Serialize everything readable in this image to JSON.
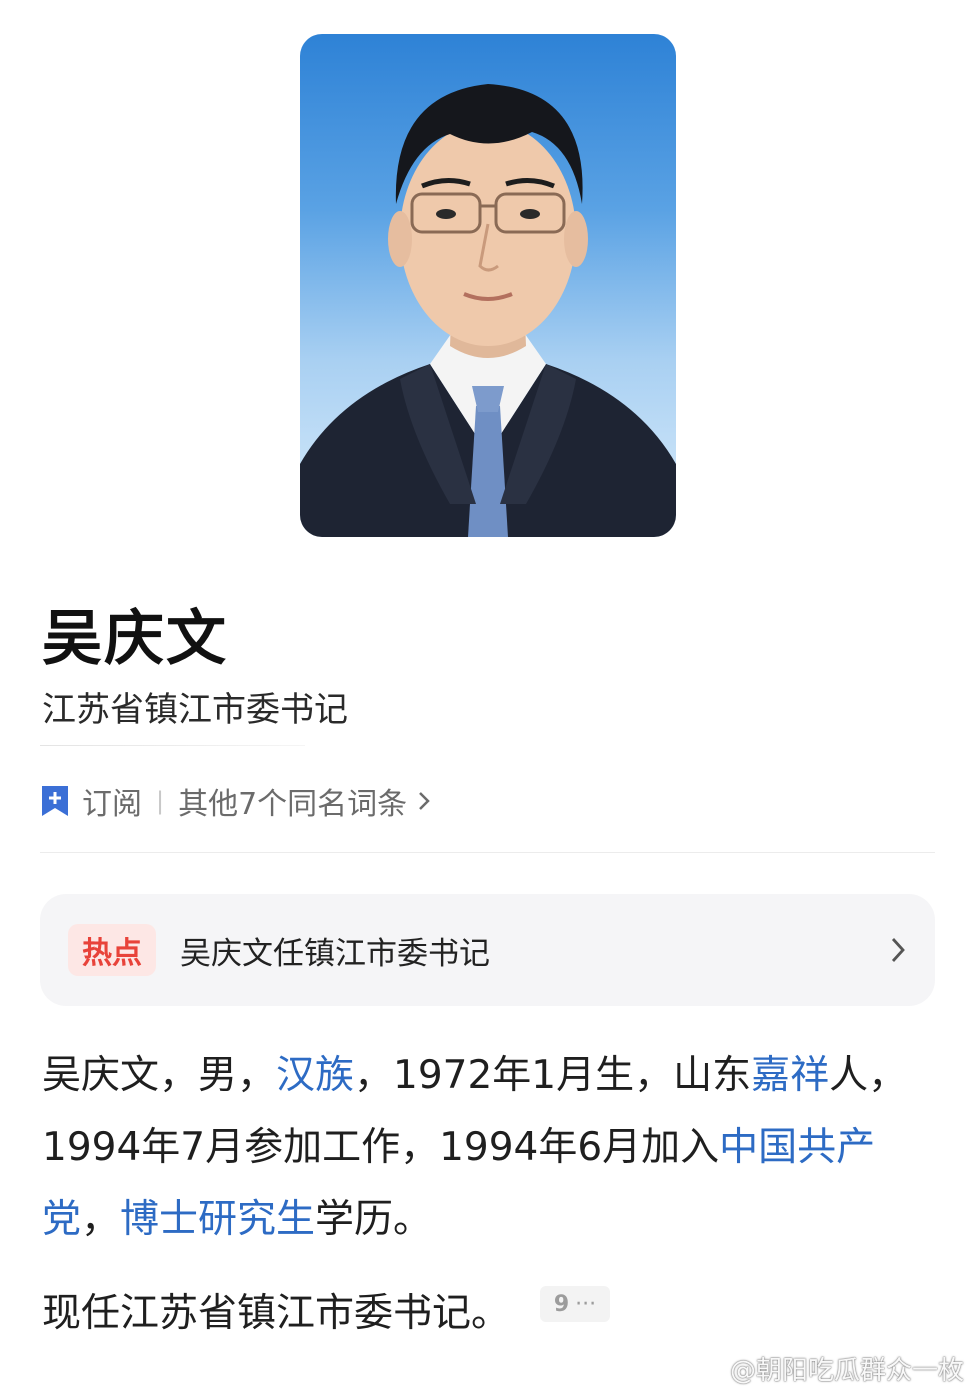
{
  "portrait": {
    "icon": "person-photo"
  },
  "profile": {
    "name": "吴庆文",
    "title": "江苏省镇江市委书记"
  },
  "actions": {
    "subscribe_label": "订阅",
    "separator": "|",
    "same_name_label": "其他7个同名词条"
  },
  "hot": {
    "badge": "热点",
    "text": "吴庆文任镇江市委书记"
  },
  "bio": {
    "p1": "吴庆文，男，",
    "ethnicity": "汉族",
    "p2": "，1972年1月生，山东",
    "birthplace": "嘉祥",
    "p3": "人，1994年7月参加工作，1994年6月加入",
    "party": "中国共产党",
    "p4": "，",
    "degree": "博士研究生",
    "p5": "学历。"
  },
  "current": {
    "text": "现任江苏省镇江市委书记。",
    "ref_number": "9",
    "ref_more": "···"
  },
  "watermark": "@朝阳吃瓜群众一枚",
  "colors": {
    "link": "#2d6bc4",
    "hot_badge_text": "#e8433a",
    "hot_badge_bg": "#fde7e5",
    "bookmark": "#3b6fd6"
  }
}
